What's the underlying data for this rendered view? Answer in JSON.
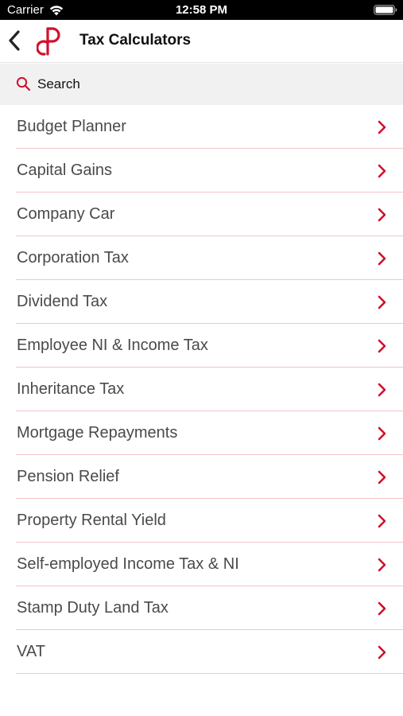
{
  "status_bar": {
    "carrier": "Carrier",
    "time": "12:58 PM",
    "icons": [
      "wifi-icon",
      "battery-icon"
    ]
  },
  "nav": {
    "title": "Tax Calculators",
    "back_icon": "chevron-left-icon",
    "logo": "app-logo"
  },
  "search": {
    "placeholder": "Search",
    "value": "",
    "icon": "search-icon"
  },
  "calculators": [
    {
      "label": "Budget Planner"
    },
    {
      "label": "Capital Gains"
    },
    {
      "label": "Company Car"
    },
    {
      "label": "Corporation Tax"
    },
    {
      "label": "Dividend Tax"
    },
    {
      "label": "Employee NI & Income Tax"
    },
    {
      "label": "Inheritance Tax"
    },
    {
      "label": "Mortgage Repayments"
    },
    {
      "label": "Pension Relief"
    },
    {
      "label": "Property Rental Yield"
    },
    {
      "label": "Self-employed Income Tax & NI"
    },
    {
      "label": "Stamp Duty Land Tax"
    },
    {
      "label": "VAT"
    }
  ],
  "colors": {
    "accent": "#d0112b",
    "separator": "#f2c5c9",
    "search_background": "#f1f1f1",
    "row_text": "#4a4a4a",
    "status_bar": "#000000"
  }
}
